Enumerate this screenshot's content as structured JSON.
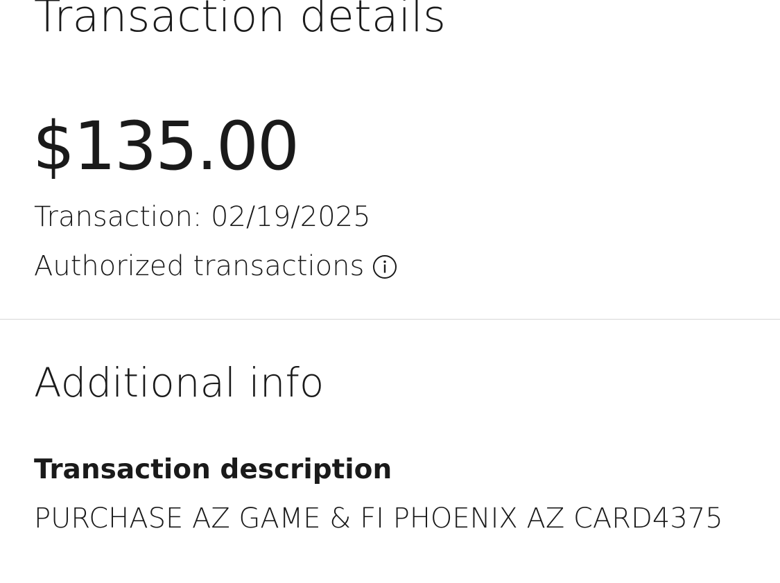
{
  "header": {
    "title": "Transaction details"
  },
  "summary": {
    "amount": "$135.00",
    "transaction_date": "Transaction: 02/19/2025",
    "status_label": "Authorized transactions",
    "status_icon": "info-icon"
  },
  "additional_info": {
    "title": "Additional info",
    "description_label": "Transaction description",
    "description_value": "PURCHASE AZ GAME & FI PHOENIX AZ CARD4375"
  },
  "colors": {
    "text": "#1a1a1a",
    "divider": "#d6d6d6",
    "background": "#ffffff"
  }
}
